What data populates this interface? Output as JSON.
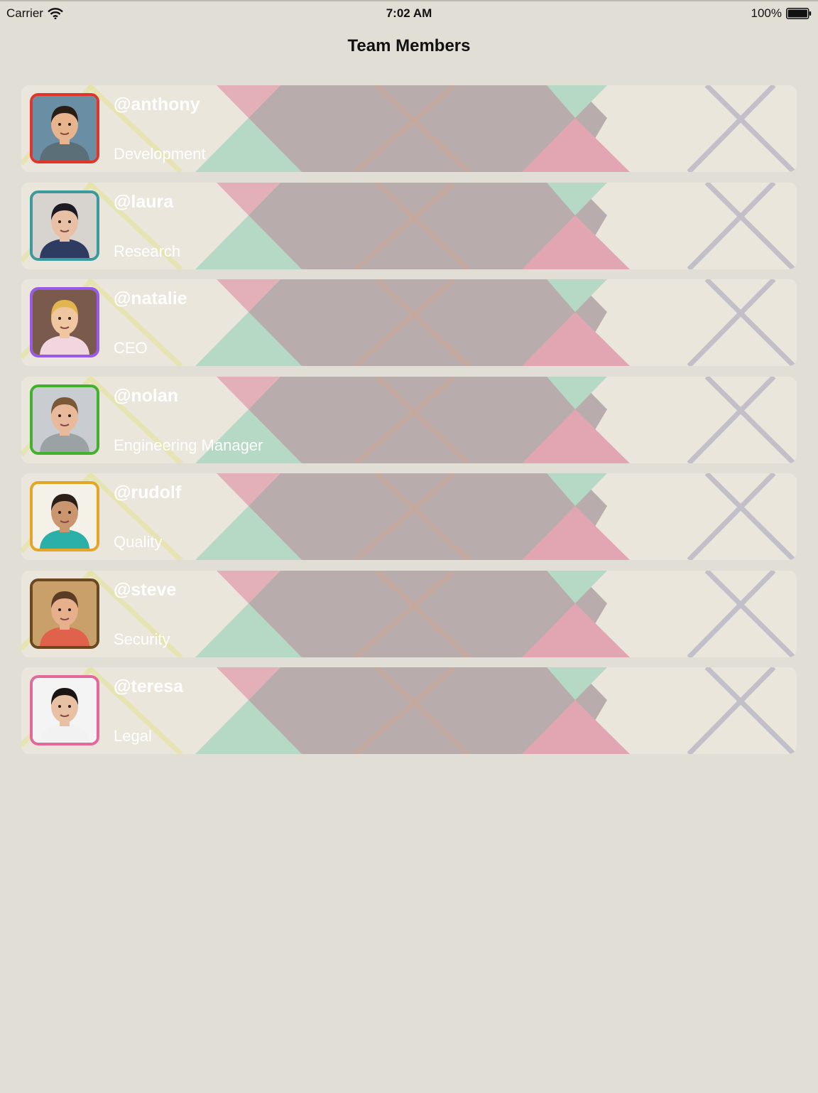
{
  "status_bar": {
    "carrier": "Carrier",
    "time": "7:02 AM",
    "battery": "100%"
  },
  "nav": {
    "title": "Team Members"
  },
  "members": [
    {
      "handle": "@anthony",
      "department": "Development",
      "border_color": "#e0352b",
      "skin": "#e8b48e",
      "hair": "#2a1d16",
      "shirt": "#5a6f78",
      "bg": "#6a8ea4"
    },
    {
      "handle": "@laura",
      "department": "Research",
      "border_color": "#3b9a9b",
      "skin": "#e8c0a6",
      "hair": "#1c1a22",
      "shirt": "#2f3c62",
      "bg": "#d7d4cf"
    },
    {
      "handle": "@natalie",
      "department": "CEO",
      "border_color": "#9a5ae8",
      "skin": "#f0c6a0",
      "hair": "#e2b54e",
      "shirt": "#f2d6df",
      "bg": "#7a5a4c"
    },
    {
      "handle": "@nolan",
      "department": "Engineering Manager",
      "border_color": "#43b02e",
      "skin": "#e8b99a",
      "hair": "#7a5838",
      "shirt": "#9aa2a6",
      "bg": "#c9ccd0"
    },
    {
      "handle": "@rudolf",
      "department": "Quality",
      "border_color": "#e4a626",
      "skin": "#c99670",
      "hair": "#2b1f18",
      "shirt": "#2ab0a8",
      "bg": "#f4f1e8"
    },
    {
      "handle": "@steve",
      "department": "Security",
      "border_color": "#6a4820",
      "skin": "#e6b08c",
      "hair": "#5a3c26",
      "shirt": "#e0614c",
      "bg": "#c9a06a"
    },
    {
      "handle": "@teresa",
      "department": "Legal",
      "border_color": "#e3699a",
      "skin": "#e8c0a4",
      "hair": "#1a1414",
      "shirt": "#f2f2f2",
      "bg": "#f4f4f4"
    }
  ]
}
